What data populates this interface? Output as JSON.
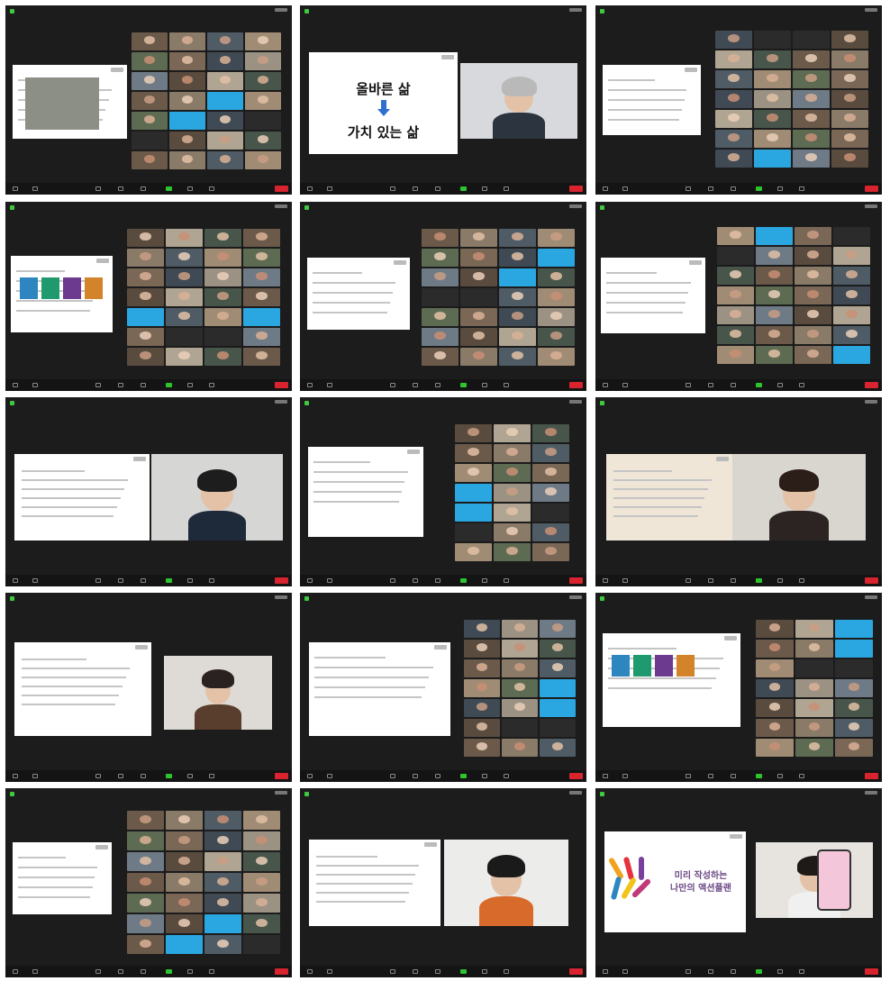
{
  "panels": [
    {
      "slide_title": "",
      "speaker_label": ""
    },
    {
      "slide_title": "",
      "line1": "올바른 삶",
      "line2": "가치 있는 삶",
      "speaker_label": ""
    },
    {
      "slide_title": "",
      "speaker_label": ""
    },
    {
      "slide_title": "",
      "speaker_label": ""
    },
    {
      "slide_title": "",
      "speaker_label": ""
    },
    {
      "slide_title": "",
      "speaker_label": ""
    },
    {
      "slide_title": "",
      "speaker_label": ""
    },
    {
      "slide_title": "",
      "speaker_label": ""
    },
    {
      "slide_title": "",
      "speaker_label": ""
    },
    {
      "slide_title": "",
      "speaker_label": ""
    },
    {
      "slide_title": "",
      "speaker_label": ""
    },
    {
      "slide_title": "",
      "speaker_label": ""
    },
    {
      "slide_title": "",
      "speaker_label": ""
    },
    {
      "slide_title": "",
      "speaker_label": ""
    },
    {
      "slide_title": "",
      "logo_line1": "미리 작성하는",
      "logo_line2": "나만의 액션플랜",
      "speaker_label": ""
    }
  ],
  "colors": {
    "zoom_bg": "#1c1c1c",
    "toolbar_bg": "#141414",
    "end_button": "#d9232e",
    "active_green": "#2ec42e",
    "blue_tile": "#2aa6e0",
    "down_arrow": "#2f6fd1"
  },
  "icons": [
    "security-shield-icon",
    "mute-icon",
    "video-icon",
    "participants-icon",
    "chat-icon",
    "share-screen-icon",
    "record-icon",
    "reactions-icon",
    "end-meeting-button"
  ]
}
